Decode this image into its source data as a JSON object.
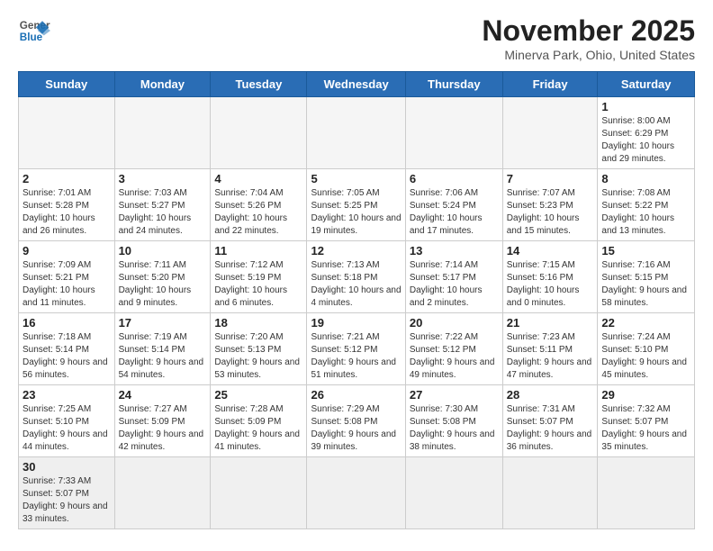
{
  "header": {
    "logo_general": "General",
    "logo_blue": "Blue",
    "month_title": "November 2025",
    "location": "Minerva Park, Ohio, United States"
  },
  "days_of_week": [
    "Sunday",
    "Monday",
    "Tuesday",
    "Wednesday",
    "Thursday",
    "Friday",
    "Saturday"
  ],
  "weeks": [
    [
      null,
      null,
      null,
      null,
      null,
      null,
      {
        "day": "1",
        "sunrise": "Sunrise: 8:00 AM",
        "sunset": "Sunset: 6:29 PM",
        "daylight": "Daylight: 10 hours and 29 minutes."
      }
    ],
    [
      {
        "day": "2",
        "sunrise": "Sunrise: 7:01 AM",
        "sunset": "Sunset: 5:28 PM",
        "daylight": "Daylight: 10 hours and 26 minutes."
      },
      {
        "day": "3",
        "sunrise": "Sunrise: 7:03 AM",
        "sunset": "Sunset: 5:27 PM",
        "daylight": "Daylight: 10 hours and 24 minutes."
      },
      {
        "day": "4",
        "sunrise": "Sunrise: 7:04 AM",
        "sunset": "Sunset: 5:26 PM",
        "daylight": "Daylight: 10 hours and 22 minutes."
      },
      {
        "day": "5",
        "sunrise": "Sunrise: 7:05 AM",
        "sunset": "Sunset: 5:25 PM",
        "daylight": "Daylight: 10 hours and 19 minutes."
      },
      {
        "day": "6",
        "sunrise": "Sunrise: 7:06 AM",
        "sunset": "Sunset: 5:24 PM",
        "daylight": "Daylight: 10 hours and 17 minutes."
      },
      {
        "day": "7",
        "sunrise": "Sunrise: 7:07 AM",
        "sunset": "Sunset: 5:23 PM",
        "daylight": "Daylight: 10 hours and 15 minutes."
      },
      {
        "day": "8",
        "sunrise": "Sunrise: 7:08 AM",
        "sunset": "Sunset: 5:22 PM",
        "daylight": "Daylight: 10 hours and 13 minutes."
      }
    ],
    [
      {
        "day": "9",
        "sunrise": "Sunrise: 7:09 AM",
        "sunset": "Sunset: 5:21 PM",
        "daylight": "Daylight: 10 hours and 11 minutes."
      },
      {
        "day": "10",
        "sunrise": "Sunrise: 7:11 AM",
        "sunset": "Sunset: 5:20 PM",
        "daylight": "Daylight: 10 hours and 9 minutes."
      },
      {
        "day": "11",
        "sunrise": "Sunrise: 7:12 AM",
        "sunset": "Sunset: 5:19 PM",
        "daylight": "Daylight: 10 hours and 6 minutes."
      },
      {
        "day": "12",
        "sunrise": "Sunrise: 7:13 AM",
        "sunset": "Sunset: 5:18 PM",
        "daylight": "Daylight: 10 hours and 4 minutes."
      },
      {
        "day": "13",
        "sunrise": "Sunrise: 7:14 AM",
        "sunset": "Sunset: 5:17 PM",
        "daylight": "Daylight: 10 hours and 2 minutes."
      },
      {
        "day": "14",
        "sunrise": "Sunrise: 7:15 AM",
        "sunset": "Sunset: 5:16 PM",
        "daylight": "Daylight: 10 hours and 0 minutes."
      },
      {
        "day": "15",
        "sunrise": "Sunrise: 7:16 AM",
        "sunset": "Sunset: 5:15 PM",
        "daylight": "Daylight: 9 hours and 58 minutes."
      }
    ],
    [
      {
        "day": "16",
        "sunrise": "Sunrise: 7:18 AM",
        "sunset": "Sunset: 5:14 PM",
        "daylight": "Daylight: 9 hours and 56 minutes."
      },
      {
        "day": "17",
        "sunrise": "Sunrise: 7:19 AM",
        "sunset": "Sunset: 5:14 PM",
        "daylight": "Daylight: 9 hours and 54 minutes."
      },
      {
        "day": "18",
        "sunrise": "Sunrise: 7:20 AM",
        "sunset": "Sunset: 5:13 PM",
        "daylight": "Daylight: 9 hours and 53 minutes."
      },
      {
        "day": "19",
        "sunrise": "Sunrise: 7:21 AM",
        "sunset": "Sunset: 5:12 PM",
        "daylight": "Daylight: 9 hours and 51 minutes."
      },
      {
        "day": "20",
        "sunrise": "Sunrise: 7:22 AM",
        "sunset": "Sunset: 5:12 PM",
        "daylight": "Daylight: 9 hours and 49 minutes."
      },
      {
        "day": "21",
        "sunrise": "Sunrise: 7:23 AM",
        "sunset": "Sunset: 5:11 PM",
        "daylight": "Daylight: 9 hours and 47 minutes."
      },
      {
        "day": "22",
        "sunrise": "Sunrise: 7:24 AM",
        "sunset": "Sunset: 5:10 PM",
        "daylight": "Daylight: 9 hours and 45 minutes."
      }
    ],
    [
      {
        "day": "23",
        "sunrise": "Sunrise: 7:25 AM",
        "sunset": "Sunset: 5:10 PM",
        "daylight": "Daylight: 9 hours and 44 minutes."
      },
      {
        "day": "24",
        "sunrise": "Sunrise: 7:27 AM",
        "sunset": "Sunset: 5:09 PM",
        "daylight": "Daylight: 9 hours and 42 minutes."
      },
      {
        "day": "25",
        "sunrise": "Sunrise: 7:28 AM",
        "sunset": "Sunset: 5:09 PM",
        "daylight": "Daylight: 9 hours and 41 minutes."
      },
      {
        "day": "26",
        "sunrise": "Sunrise: 7:29 AM",
        "sunset": "Sunset: 5:08 PM",
        "daylight": "Daylight: 9 hours and 39 minutes."
      },
      {
        "day": "27",
        "sunrise": "Sunrise: 7:30 AM",
        "sunset": "Sunset: 5:08 PM",
        "daylight": "Daylight: 9 hours and 38 minutes."
      },
      {
        "day": "28",
        "sunrise": "Sunrise: 7:31 AM",
        "sunset": "Sunset: 5:07 PM",
        "daylight": "Daylight: 9 hours and 36 minutes."
      },
      {
        "day": "29",
        "sunrise": "Sunrise: 7:32 AM",
        "sunset": "Sunset: 5:07 PM",
        "daylight": "Daylight: 9 hours and 35 minutes."
      }
    ],
    [
      {
        "day": "30",
        "sunrise": "Sunrise: 7:33 AM",
        "sunset": "Sunset: 5:07 PM",
        "daylight": "Daylight: 9 hours and 33 minutes."
      },
      null,
      null,
      null,
      null,
      null,
      null
    ]
  ]
}
